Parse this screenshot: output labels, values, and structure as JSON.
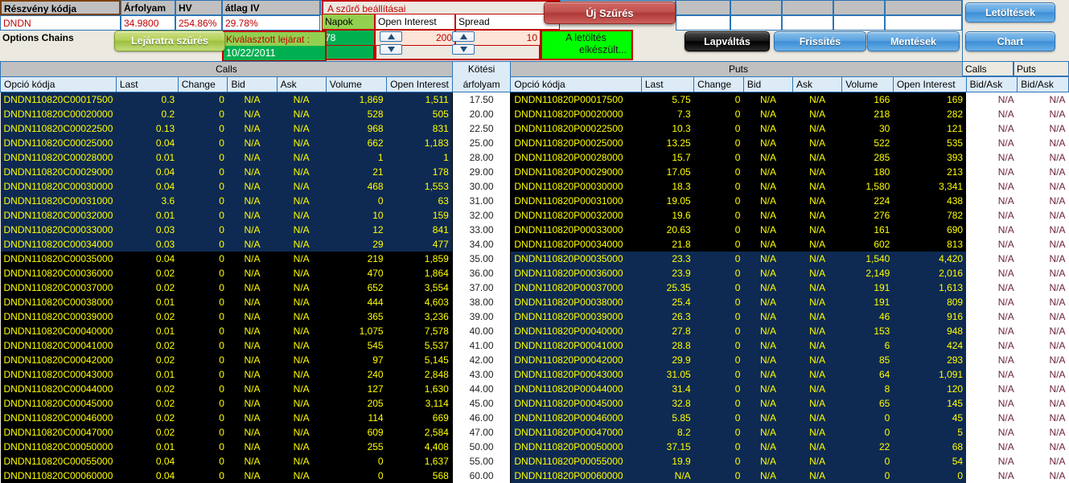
{
  "top": {
    "stock_code_label": "Részvény kódja",
    "stock_code_value": "DNDN",
    "options_chains_label": "Options Chains",
    "price_label": "Árfolyam",
    "price_value": "34.9800",
    "hv_label": "HV",
    "hv_value": "254.86%",
    "avg_iv_label": "átlag IV",
    "avg_iv_value": "29.78%",
    "filter_title": "A szűrő beállításai",
    "days_label": "Napok",
    "days_value": "78",
    "open_interest_label": "Open Interest",
    "open_interest_value": "200",
    "spread_label": "Spread",
    "spread_value": "10",
    "expiry_label": "Kiválasztott lejárat :",
    "expiry_value": "10/22/2011",
    "status_line1": "A letöltés",
    "status_line2": "elkészült...",
    "buttons": {
      "filter_expiry": "Lejáratra szűrés",
      "new_filter": "Új Szűrés",
      "page_change": "Lapváltás",
      "refresh": "Frissítés",
      "saves": "Mentések",
      "downloads": "Letöltések",
      "chart": "Chart"
    },
    "colors": {
      "accent_red": "#c00000",
      "accent_green": "#00b050",
      "status_green": "#00ff00",
      "blue_button": "#3d8ed6",
      "grid_blue": "#2e75b6"
    }
  },
  "chain": {
    "calls_group_label": "Calls",
    "puts_group_label": "Puts",
    "strike_header_line1": "Kötési",
    "strike_header_line2": "árfolyam",
    "calls_ba_group": "Calls",
    "puts_ba_group": "Puts",
    "ba_header": "Bid/Ask",
    "columns": [
      "Opció kódja",
      "Last",
      "Change",
      "Bid",
      "Ask",
      "Volume",
      "Open Interest"
    ],
    "rows": [
      {
        "strike": "17.50",
        "call": {
          "code": "DNDN110820C00017500",
          "last": "0.3",
          "change": "0",
          "bid": "N/A",
          "ask": "N/A",
          "volume": "1,869",
          "oi": "1,511",
          "bg": "navy"
        },
        "put": {
          "code": "DNDN110820P00017500",
          "last": "5.75",
          "change": "0",
          "bid": "N/A",
          "ask": "N/A",
          "volume": "166",
          "oi": "169",
          "bg": "black"
        },
        "call_ba": "N/A",
        "put_ba": "N/A"
      },
      {
        "strike": "20.00",
        "call": {
          "code": "DNDN110820C00020000",
          "last": "0.2",
          "change": "0",
          "bid": "N/A",
          "ask": "N/A",
          "volume": "528",
          "oi": "505",
          "bg": "navy"
        },
        "put": {
          "code": "DNDN110820P00020000",
          "last": "7.3",
          "change": "0",
          "bid": "N/A",
          "ask": "N/A",
          "volume": "218",
          "oi": "282",
          "bg": "black"
        },
        "call_ba": "N/A",
        "put_ba": "N/A"
      },
      {
        "strike": "22.50",
        "call": {
          "code": "DNDN110820C00022500",
          "last": "0.13",
          "change": "0",
          "bid": "N/A",
          "ask": "N/A",
          "volume": "968",
          "oi": "831",
          "bg": "navy"
        },
        "put": {
          "code": "DNDN110820P00022500",
          "last": "10.3",
          "change": "0",
          "bid": "N/A",
          "ask": "N/A",
          "volume": "30",
          "oi": "121",
          "bg": "black"
        },
        "call_ba": "N/A",
        "put_ba": "N/A"
      },
      {
        "strike": "25.00",
        "call": {
          "code": "DNDN110820C00025000",
          "last": "0.04",
          "change": "0",
          "bid": "N/A",
          "ask": "N/A",
          "volume": "662",
          "oi": "1,183",
          "bg": "navy"
        },
        "put": {
          "code": "DNDN110820P00025000",
          "last": "13.25",
          "change": "0",
          "bid": "N/A",
          "ask": "N/A",
          "volume": "522",
          "oi": "535",
          "bg": "black"
        },
        "call_ba": "N/A",
        "put_ba": "N/A"
      },
      {
        "strike": "28.00",
        "call": {
          "code": "DNDN110820C00028000",
          "last": "0.01",
          "change": "0",
          "bid": "N/A",
          "ask": "N/A",
          "volume": "1",
          "oi": "1",
          "bg": "navy"
        },
        "put": {
          "code": "DNDN110820P00028000",
          "last": "15.7",
          "change": "0",
          "bid": "N/A",
          "ask": "N/A",
          "volume": "285",
          "oi": "393",
          "bg": "black"
        },
        "call_ba": "N/A",
        "put_ba": "N/A"
      },
      {
        "strike": "29.00",
        "call": {
          "code": "DNDN110820C00029000",
          "last": "0.04",
          "change": "0",
          "bid": "N/A",
          "ask": "N/A",
          "volume": "21",
          "oi": "178",
          "bg": "navy"
        },
        "put": {
          "code": "DNDN110820P00029000",
          "last": "17.05",
          "change": "0",
          "bid": "N/A",
          "ask": "N/A",
          "volume": "180",
          "oi": "213",
          "bg": "black"
        },
        "call_ba": "N/A",
        "put_ba": "N/A"
      },
      {
        "strike": "30.00",
        "call": {
          "code": "DNDN110820C00030000",
          "last": "0.04",
          "change": "0",
          "bid": "N/A",
          "ask": "N/A",
          "volume": "468",
          "oi": "1,553",
          "bg": "navy"
        },
        "put": {
          "code": "DNDN110820P00030000",
          "last": "18.3",
          "change": "0",
          "bid": "N/A",
          "ask": "N/A",
          "volume": "1,580",
          "oi": "3,341",
          "bg": "black"
        },
        "call_ba": "N/A",
        "put_ba": "N/A"
      },
      {
        "strike": "31.00",
        "call": {
          "code": "DNDN110820C00031000",
          "last": "3.6",
          "change": "0",
          "bid": "N/A",
          "ask": "N/A",
          "volume": "0",
          "oi": "63",
          "bg": "navy"
        },
        "put": {
          "code": "DNDN110820P00031000",
          "last": "19.05",
          "change": "0",
          "bid": "N/A",
          "ask": "N/A",
          "volume": "224",
          "oi": "438",
          "bg": "black"
        },
        "call_ba": "N/A",
        "put_ba": "N/A"
      },
      {
        "strike": "32.00",
        "call": {
          "code": "DNDN110820C00032000",
          "last": "0.01",
          "change": "0",
          "bid": "N/A",
          "ask": "N/A",
          "volume": "10",
          "oi": "159",
          "bg": "navy"
        },
        "put": {
          "code": "DNDN110820P00032000",
          "last": "19.6",
          "change": "0",
          "bid": "N/A",
          "ask": "N/A",
          "volume": "276",
          "oi": "782",
          "bg": "black"
        },
        "call_ba": "N/A",
        "put_ba": "N/A"
      },
      {
        "strike": "33.00",
        "call": {
          "code": "DNDN110820C00033000",
          "last": "0.03",
          "change": "0",
          "bid": "N/A",
          "ask": "N/A",
          "volume": "12",
          "oi": "841",
          "bg": "navy"
        },
        "put": {
          "code": "DNDN110820P00033000",
          "last": "20.63",
          "change": "0",
          "bid": "N/A",
          "ask": "N/A",
          "volume": "161",
          "oi": "690",
          "bg": "black"
        },
        "call_ba": "N/A",
        "put_ba": "N/A"
      },
      {
        "strike": "34.00",
        "call": {
          "code": "DNDN110820C00034000",
          "last": "0.03",
          "change": "0",
          "bid": "N/A",
          "ask": "N/A",
          "volume": "29",
          "oi": "477",
          "bg": "navy"
        },
        "put": {
          "code": "DNDN110820P00034000",
          "last": "21.8",
          "change": "0",
          "bid": "N/A",
          "ask": "N/A",
          "volume": "602",
          "oi": "813",
          "bg": "black"
        },
        "call_ba": "N/A",
        "put_ba": "N/A"
      },
      {
        "strike": "35.00",
        "call": {
          "code": "DNDN110820C00035000",
          "last": "0.04",
          "change": "0",
          "bid": "N/A",
          "ask": "N/A",
          "volume": "219",
          "oi": "1,859",
          "bg": "black"
        },
        "put": {
          "code": "DNDN110820P00035000",
          "last": "23.3",
          "change": "0",
          "bid": "N/A",
          "ask": "N/A",
          "volume": "1,540",
          "oi": "4,420",
          "bg": "navy"
        },
        "call_ba": "N/A",
        "put_ba": "N/A"
      },
      {
        "strike": "36.00",
        "call": {
          "code": "DNDN110820C00036000",
          "last": "0.02",
          "change": "0",
          "bid": "N/A",
          "ask": "N/A",
          "volume": "470",
          "oi": "1,864",
          "bg": "black"
        },
        "put": {
          "code": "DNDN110820P00036000",
          "last": "23.9",
          "change": "0",
          "bid": "N/A",
          "ask": "N/A",
          "volume": "2,149",
          "oi": "2,016",
          "bg": "navy"
        },
        "call_ba": "N/A",
        "put_ba": "N/A"
      },
      {
        "strike": "37.00",
        "call": {
          "code": "DNDN110820C00037000",
          "last": "0.02",
          "change": "0",
          "bid": "N/A",
          "ask": "N/A",
          "volume": "652",
          "oi": "3,554",
          "bg": "black"
        },
        "put": {
          "code": "DNDN110820P00037000",
          "last": "25.35",
          "change": "0",
          "bid": "N/A",
          "ask": "N/A",
          "volume": "191",
          "oi": "1,613",
          "bg": "navy"
        },
        "call_ba": "N/A",
        "put_ba": "N/A"
      },
      {
        "strike": "38.00",
        "call": {
          "code": "DNDN110820C00038000",
          "last": "0.01",
          "change": "0",
          "bid": "N/A",
          "ask": "N/A",
          "volume": "444",
          "oi": "4,603",
          "bg": "black"
        },
        "put": {
          "code": "DNDN110820P00038000",
          "last": "25.4",
          "change": "0",
          "bid": "N/A",
          "ask": "N/A",
          "volume": "191",
          "oi": "809",
          "bg": "navy"
        },
        "call_ba": "N/A",
        "put_ba": "N/A"
      },
      {
        "strike": "39.00",
        "call": {
          "code": "DNDN110820C00039000",
          "last": "0.02",
          "change": "0",
          "bid": "N/A",
          "ask": "N/A",
          "volume": "365",
          "oi": "3,236",
          "bg": "black"
        },
        "put": {
          "code": "DNDN110820P00039000",
          "last": "26.3",
          "change": "0",
          "bid": "N/A",
          "ask": "N/A",
          "volume": "46",
          "oi": "916",
          "bg": "navy"
        },
        "call_ba": "N/A",
        "put_ba": "N/A"
      },
      {
        "strike": "40.00",
        "call": {
          "code": "DNDN110820C00040000",
          "last": "0.01",
          "change": "0",
          "bid": "N/A",
          "ask": "N/A",
          "volume": "1,075",
          "oi": "7,578",
          "bg": "black"
        },
        "put": {
          "code": "DNDN110820P00040000",
          "last": "27.8",
          "change": "0",
          "bid": "N/A",
          "ask": "N/A",
          "volume": "153",
          "oi": "948",
          "bg": "navy"
        },
        "call_ba": "N/A",
        "put_ba": "N/A"
      },
      {
        "strike": "41.00",
        "call": {
          "code": "DNDN110820C00041000",
          "last": "0.02",
          "change": "0",
          "bid": "N/A",
          "ask": "N/A",
          "volume": "545",
          "oi": "5,537",
          "bg": "black"
        },
        "put": {
          "code": "DNDN110820P00041000",
          "last": "28.8",
          "change": "0",
          "bid": "N/A",
          "ask": "N/A",
          "volume": "6",
          "oi": "424",
          "bg": "navy"
        },
        "call_ba": "N/A",
        "put_ba": "N/A"
      },
      {
        "strike": "42.00",
        "call": {
          "code": "DNDN110820C00042000",
          "last": "0.02",
          "change": "0",
          "bid": "N/A",
          "ask": "N/A",
          "volume": "97",
          "oi": "5,145",
          "bg": "black"
        },
        "put": {
          "code": "DNDN110820P00042000",
          "last": "29.9",
          "change": "0",
          "bid": "N/A",
          "ask": "N/A",
          "volume": "85",
          "oi": "293",
          "bg": "navy"
        },
        "call_ba": "N/A",
        "put_ba": "N/A"
      },
      {
        "strike": "43.00",
        "call": {
          "code": "DNDN110820C00043000",
          "last": "0.01",
          "change": "0",
          "bid": "N/A",
          "ask": "N/A",
          "volume": "240",
          "oi": "2,848",
          "bg": "black"
        },
        "put": {
          "code": "DNDN110820P00043000",
          "last": "31.05",
          "change": "0",
          "bid": "N/A",
          "ask": "N/A",
          "volume": "64",
          "oi": "1,091",
          "bg": "navy"
        },
        "call_ba": "N/A",
        "put_ba": "N/A"
      },
      {
        "strike": "44.00",
        "call": {
          "code": "DNDN110820C00044000",
          "last": "0.02",
          "change": "0",
          "bid": "N/A",
          "ask": "N/A",
          "volume": "127",
          "oi": "1,630",
          "bg": "black"
        },
        "put": {
          "code": "DNDN110820P00044000",
          "last": "31.4",
          "change": "0",
          "bid": "N/A",
          "ask": "N/A",
          "volume": "8",
          "oi": "120",
          "bg": "navy"
        },
        "call_ba": "N/A",
        "put_ba": "N/A"
      },
      {
        "strike": "45.00",
        "call": {
          "code": "DNDN110820C00045000",
          "last": "0.02",
          "change": "0",
          "bid": "N/A",
          "ask": "N/A",
          "volume": "205",
          "oi": "3,114",
          "bg": "black"
        },
        "put": {
          "code": "DNDN110820P00045000",
          "last": "32.8",
          "change": "0",
          "bid": "N/A",
          "ask": "N/A",
          "volume": "65",
          "oi": "145",
          "bg": "navy"
        },
        "call_ba": "N/A",
        "put_ba": "N/A"
      },
      {
        "strike": "46.00",
        "call": {
          "code": "DNDN110820C00046000",
          "last": "0.02",
          "change": "0",
          "bid": "N/A",
          "ask": "N/A",
          "volume": "114",
          "oi": "669",
          "bg": "black"
        },
        "put": {
          "code": "DNDN110820P00046000",
          "last": "5.85",
          "change": "0",
          "bid": "N/A",
          "ask": "N/A",
          "volume": "0",
          "oi": "45",
          "bg": "navy"
        },
        "call_ba": "N/A",
        "put_ba": "N/A"
      },
      {
        "strike": "47.00",
        "call": {
          "code": "DNDN110820C00047000",
          "last": "0.02",
          "change": "0",
          "bid": "N/A",
          "ask": "N/A",
          "volume": "609",
          "oi": "2,584",
          "bg": "black"
        },
        "put": {
          "code": "DNDN110820P00047000",
          "last": "8.2",
          "change": "0",
          "bid": "N/A",
          "ask": "N/A",
          "volume": "0",
          "oi": "5",
          "bg": "navy"
        },
        "call_ba": "N/A",
        "put_ba": "N/A"
      },
      {
        "strike": "50.00",
        "call": {
          "code": "DNDN110820C00050000",
          "last": "0.01",
          "change": "0",
          "bid": "N/A",
          "ask": "N/A",
          "volume": "255",
          "oi": "4,408",
          "bg": "black"
        },
        "put": {
          "code": "DNDN110820P00050000",
          "last": "37.15",
          "change": "0",
          "bid": "N/A",
          "ask": "N/A",
          "volume": "22",
          "oi": "68",
          "bg": "navy"
        },
        "call_ba": "N/A",
        "put_ba": "N/A"
      },
      {
        "strike": "55.00",
        "call": {
          "code": "DNDN110820C00055000",
          "last": "0.04",
          "change": "0",
          "bid": "N/A",
          "ask": "N/A",
          "volume": "0",
          "oi": "1,637",
          "bg": "black"
        },
        "put": {
          "code": "DNDN110820P00055000",
          "last": "19.9",
          "change": "0",
          "bid": "N/A",
          "ask": "N/A",
          "volume": "0",
          "oi": "54",
          "bg": "navy"
        },
        "call_ba": "N/A",
        "put_ba": "N/A"
      },
      {
        "strike": "60.00",
        "call": {
          "code": "DNDN110820C00060000",
          "last": "0.04",
          "change": "0",
          "bid": "N/A",
          "ask": "N/A",
          "volume": "0",
          "oi": "568",
          "bg": "black"
        },
        "put": {
          "code": "DNDN110820P00060000",
          "last": "N/A",
          "change": "0",
          "bid": "N/A",
          "ask": "N/A",
          "volume": "0",
          "oi": "0",
          "bg": "navy"
        },
        "call_ba": "N/A",
        "put_ba": "N/A"
      }
    ]
  }
}
